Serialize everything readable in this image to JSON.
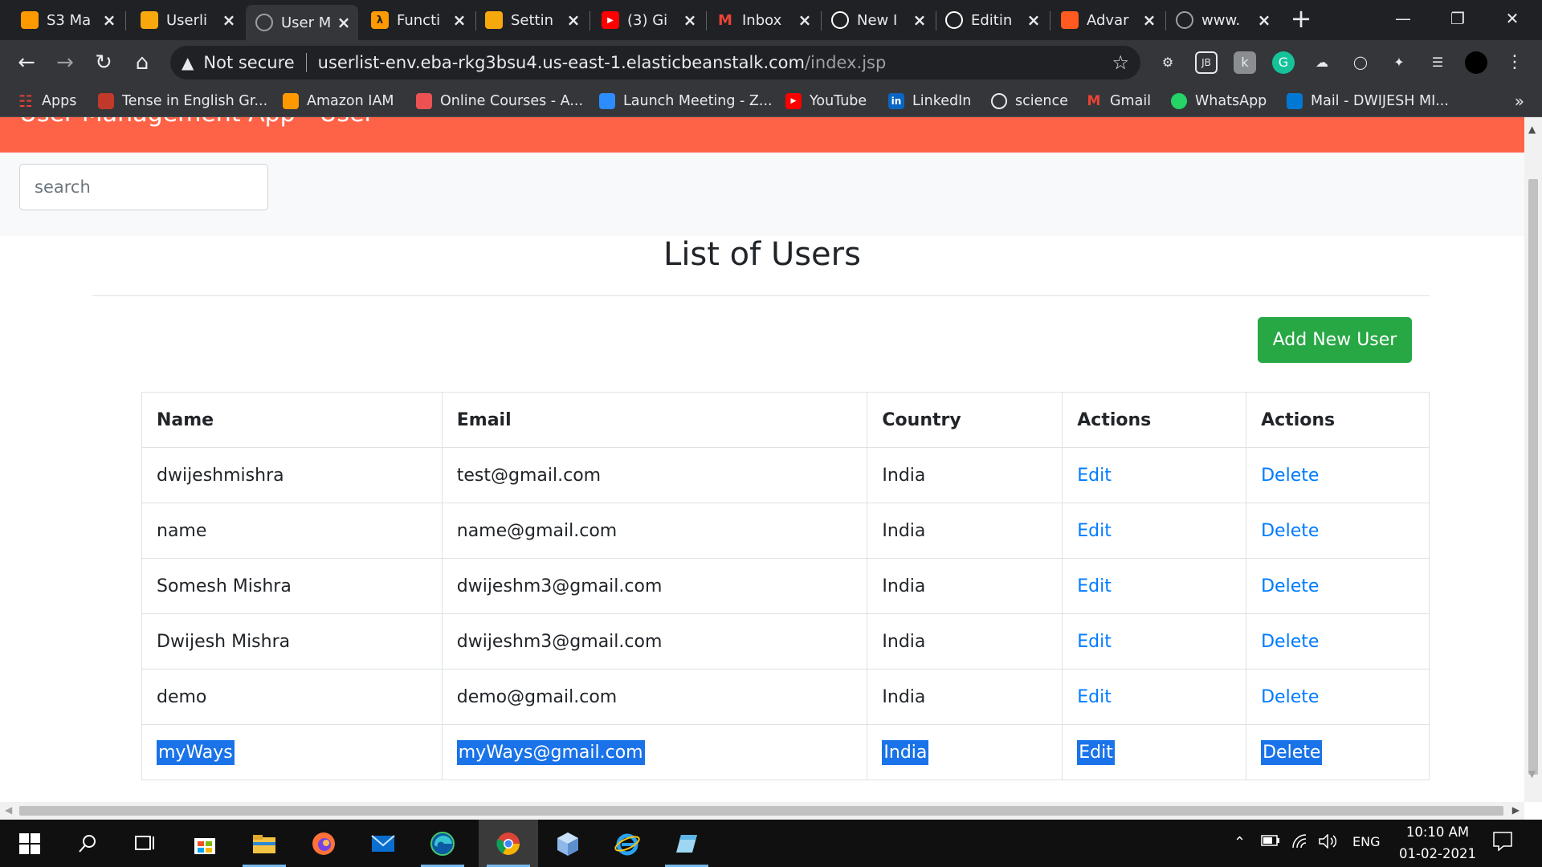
{
  "browser": {
    "tabs": [
      {
        "title": "S3 Ma",
        "icon": "aws-s3-icon",
        "color": "#ff9900"
      },
      {
        "title": "Userli",
        "icon": "elasticbeanstalk-icon",
        "color": "#f7a80d"
      },
      {
        "title": "User M",
        "icon": "globe-icon",
        "color": "#5f6368",
        "active": true
      },
      {
        "title": "Functi",
        "icon": "lambda-icon",
        "color": "#ff9900"
      },
      {
        "title": "Settin",
        "icon": "elasticbeanstalk-icon",
        "color": "#f7a80d"
      },
      {
        "title": "(3) Gi",
        "icon": "youtube-icon",
        "color": "#ff0000"
      },
      {
        "title": "Inbox",
        "icon": "gmail-icon",
        "color": "#ea4335"
      },
      {
        "title": "New I",
        "icon": "github-icon",
        "color": "#ffffff"
      },
      {
        "title": "Editin",
        "icon": "github-icon",
        "color": "#ffffff"
      },
      {
        "title": "Advar",
        "icon": "adv-icon",
        "color": "#ff5a1f"
      },
      {
        "title": "www.",
        "icon": "globe-icon",
        "color": "#5f6368"
      }
    ],
    "address": {
      "security": "Not secure",
      "host": "userlist-env.eba-rkg3bsu4.us-east-1.elasticbeanstalk.com",
      "path": "/index.jsp"
    },
    "bookmarks": [
      {
        "label": "Apps",
        "icon": "apps-grid-icon",
        "color": "#4285f4"
      },
      {
        "label": "Tense in English Gr...",
        "icon": "book-icon",
        "color": "#c0392b"
      },
      {
        "label": "Amazon IAM",
        "icon": "aws-icon",
        "color": "#ff9900"
      },
      {
        "label": "Online Courses - A...",
        "icon": "udemy-icon",
        "color": "#ec5252"
      },
      {
        "label": "Launch Meeting - Z...",
        "icon": "zoom-icon",
        "color": "#2d8cff"
      },
      {
        "label": "YouTube",
        "icon": "youtube-icon",
        "color": "#ff0000"
      },
      {
        "label": "LinkedIn",
        "icon": "linkedin-icon",
        "color": "#0a66c2"
      },
      {
        "label": "science",
        "icon": "globe-icon",
        "color": "#5f6368"
      },
      {
        "label": "Gmail",
        "icon": "gmail-icon",
        "color": "#ea4335"
      },
      {
        "label": "WhatsApp",
        "icon": "whatsapp-icon",
        "color": "#25d366"
      },
      {
        "label": "Mail - DWIJESH MI...",
        "icon": "outlook-icon",
        "color": "#0078d4"
      }
    ]
  },
  "app": {
    "brand": "User Management App - User",
    "search_placeholder": "search",
    "page_title": "List of Users",
    "add_button": "Add New User",
    "columns": [
      "Name",
      "Email",
      "Country",
      "Actions",
      "Actions"
    ],
    "edit_label": "Edit",
    "delete_label": "Delete",
    "users": [
      {
        "name": "dwijeshmishra",
        "email": "test@gmail.com",
        "country": "India",
        "selected": false
      },
      {
        "name": "name",
        "email": "name@gmail.com",
        "country": "India",
        "selected": false
      },
      {
        "name": "Somesh Mishra",
        "email": "dwijeshm3@gmail.com",
        "country": "India",
        "selected": false
      },
      {
        "name": "Dwijesh Mishra",
        "email": "dwijeshm3@gmail.com",
        "country": "India",
        "selected": false
      },
      {
        "name": "demo",
        "email": "demo@gmail.com",
        "country": "India",
        "selected": false
      },
      {
        "name": "myWays",
        "email": "myWays@gmail.com",
        "country": "India",
        "selected": true
      }
    ]
  },
  "taskbar": {
    "language": "ENG",
    "time": "10:10 AM",
    "date": "01-02-2021"
  },
  "colors": {
    "app_header": "#ff6347",
    "add_button": "#28a745",
    "link": "#007bff",
    "selection": "#1a73e8"
  }
}
